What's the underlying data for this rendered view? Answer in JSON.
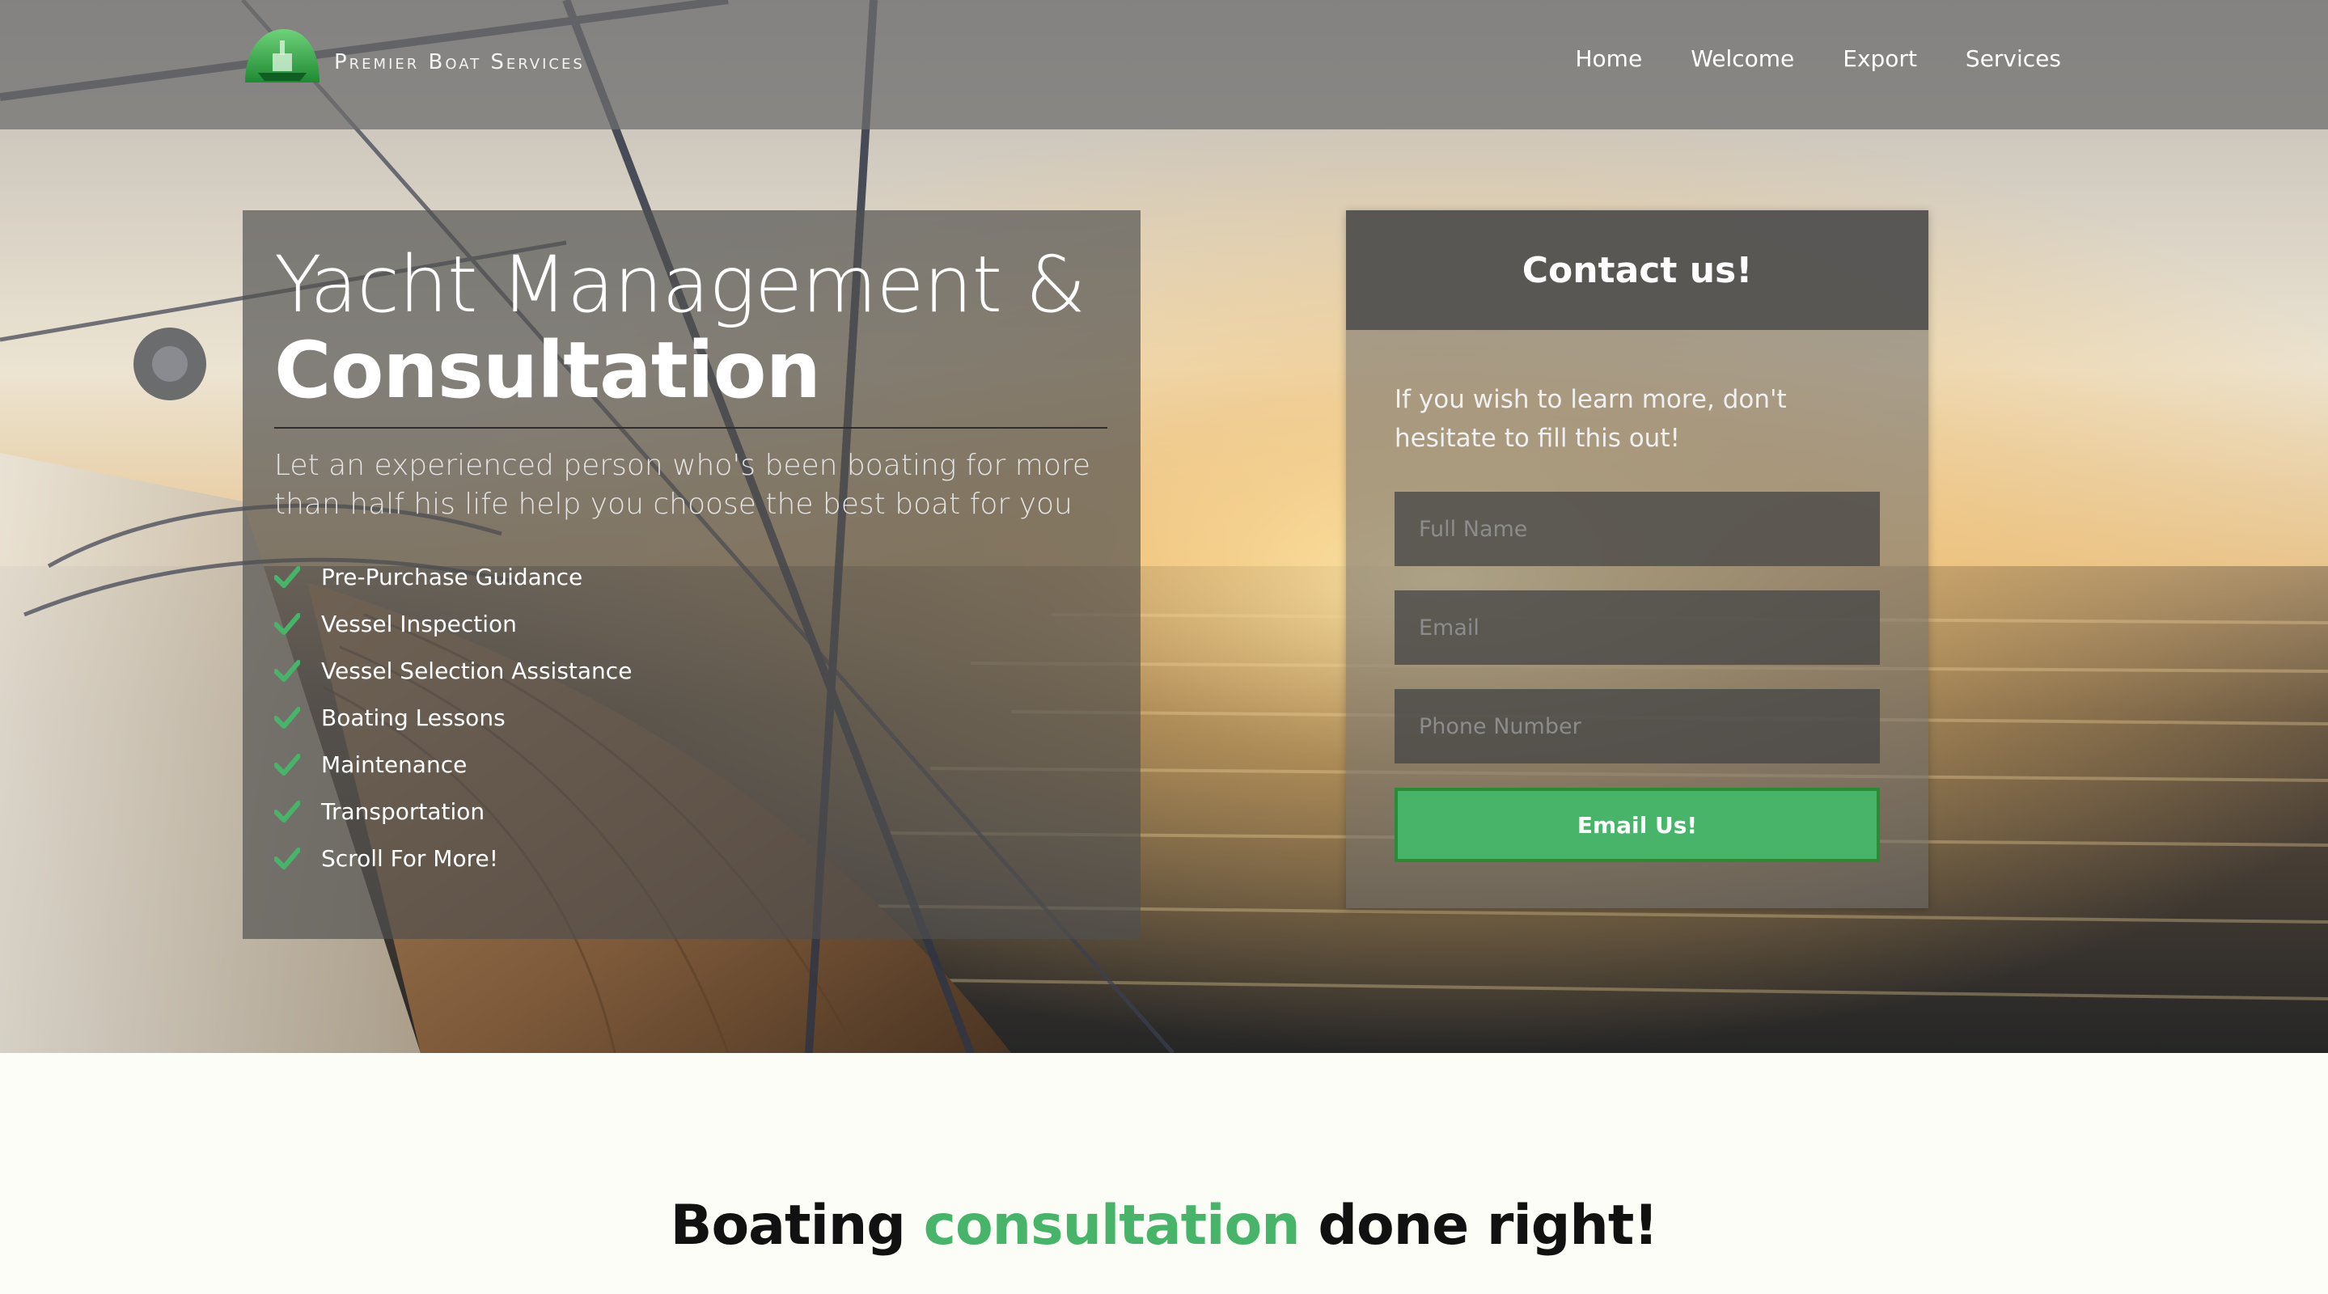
{
  "brand": {
    "name": "Premier Boat Services",
    "logo_icon": "boat-logo-icon"
  },
  "nav": {
    "items": [
      {
        "label": "Home"
      },
      {
        "label": "Welcome"
      },
      {
        "label": "Export"
      },
      {
        "label": "Services"
      }
    ]
  },
  "hero": {
    "title_light": "Yacht Management &",
    "title_bold": "Consultation",
    "lead": "Let an experienced person who's been boating for more than half his life help you choose the best boat for you",
    "services": [
      {
        "label": "Pre-Purchase Guidance",
        "icon": "check-icon"
      },
      {
        "label": "Vessel Inspection",
        "icon": "check-icon"
      },
      {
        "label": "Vessel Selection Assistance",
        "icon": "check-icon"
      },
      {
        "label": "Boating Lessons",
        "icon": "check-icon"
      },
      {
        "label": "Maintenance",
        "icon": "check-icon"
      },
      {
        "label": "Transportation",
        "icon": "check-icon"
      },
      {
        "label": "Scroll For More!",
        "icon": "check-icon"
      }
    ]
  },
  "contact": {
    "title": "Contact us!",
    "intro": "If you wish to learn more, don't hesitate to fill this out!",
    "fields": {
      "name_placeholder": "Full Name",
      "email_placeholder": "Email",
      "phone_placeholder": "Phone Number"
    },
    "submit_label": "Email Us!"
  },
  "tagline": {
    "before": "Boating",
    "accent": "consultation",
    "after": "done right!"
  },
  "colors": {
    "accent_green": "#48b46a",
    "button_border": "#2c8a35",
    "nav_bar": "#6e6e6e",
    "page_background": "#fdfdf7"
  }
}
